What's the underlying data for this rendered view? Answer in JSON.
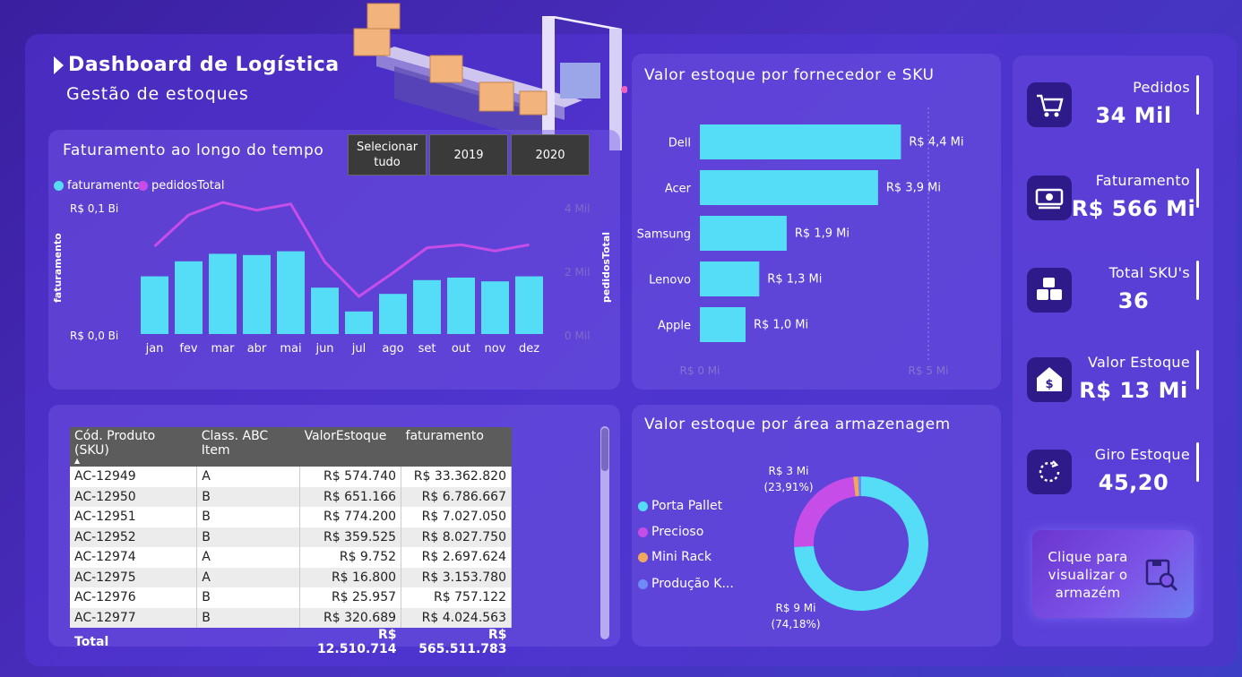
{
  "header": {
    "title": "Dashboard de Logística",
    "subtitle": "Gestão de estoques"
  },
  "colors": {
    "cyan": "#55ddf7",
    "magenta": "#c64de8",
    "orange": "#f0a860",
    "blue": "#6d8af5",
    "background": "#4a2fc0"
  },
  "line_chart": {
    "title": "Faturamento ao longo do tempo",
    "legend": [
      "faturamento",
      "pedidosTotal"
    ],
    "y_left_top": "R$ 0,1 Bi",
    "y_left_bottom": "R$ 0,0 Bi",
    "y_left_axis": "faturamento",
    "y_right_axis": "pedidosTotal",
    "y_right_ticks": [
      "4 Mil",
      "2 Mil",
      "0 Mil"
    ]
  },
  "slicers": [
    "Selecionar tudo",
    "2019",
    "2020"
  ],
  "bar_chart": {
    "title": "Valor estoque por fornecedor e SKU",
    "x_ticks": [
      "R$ 0 Mi",
      "R$ 5 Mi"
    ]
  },
  "donut": {
    "title": "Valor estoque por área armazenagem",
    "legend": [
      "Porta Pallet",
      "Precioso",
      "Mini Rack",
      "Produção K..."
    ],
    "label_small": "R$ 3 Mi",
    "label_small_pct": "(23,91%)",
    "label_big": "R$ 9 Mi",
    "label_big_pct": "(74,18%)"
  },
  "table": {
    "headers": [
      "Cód. Produto (SKU)",
      "Class. ABC Item",
      "ValorEstoque",
      "faturamento"
    ],
    "rows": [
      [
        "AC-12949",
        "A",
        "R$ 574.740",
        "R$ 33.362.820"
      ],
      [
        "AC-12950",
        "B",
        "R$ 651.166",
        "R$ 6.786.667"
      ],
      [
        "AC-12951",
        "B",
        "R$ 774.200",
        "R$ 7.027.050"
      ],
      [
        "AC-12952",
        "B",
        "R$ 359.525",
        "R$ 8.027.750"
      ],
      [
        "AC-12974",
        "A",
        "R$ 9.752",
        "R$ 2.697.624"
      ],
      [
        "AC-12975",
        "A",
        "R$ 16.800",
        "R$ 3.153.780"
      ],
      [
        "AC-12976",
        "B",
        "R$ 25.957",
        "R$ 757.122"
      ],
      [
        "AC-12977",
        "B",
        "R$ 320.689",
        "R$ 4.024.563"
      ]
    ],
    "total": [
      "Total",
      "",
      "R$ 12.510.714",
      "R$ 565.511.783"
    ]
  },
  "kpis": [
    {
      "label": "Pedidos",
      "value": "34 Mil",
      "icon": "cart-icon"
    },
    {
      "label": "Faturamento",
      "value": "R$ 566 Mi",
      "icon": "money-icon"
    },
    {
      "label": "Total SKU's",
      "value": "36",
      "icon": "boxes-icon"
    },
    {
      "label": "Valor Estoque",
      "value": "R$ 13 Mi",
      "icon": "warehouse-dollar-icon"
    },
    {
      "label": "Giro Estoque",
      "value": "45,20",
      "icon": "cycle-icon"
    }
  ],
  "cta": {
    "label": "Clique para visualizar o armazém",
    "icon": "search-box-icon"
  },
  "chart_data": [
    {
      "type": "bar",
      "title": "Faturamento ao longo do tempo",
      "categories": [
        "jan",
        "fev",
        "mar",
        "abr",
        "mai",
        "jun",
        "jul",
        "ago",
        "set",
        "out",
        "nov",
        "dez"
      ],
      "series": [
        {
          "name": "faturamento",
          "values": [
            0.046,
            0.058,
            0.064,
            0.063,
            0.066,
            0.037,
            0.018,
            0.032,
            0.043,
            0.045,
            0.042,
            0.046
          ]
        },
        {
          "name": "pedidosTotal",
          "values": [
            2800,
            3800,
            4200,
            3950,
            4150,
            2300,
            1200,
            1950,
            2750,
            2850,
            2650,
            2850
          ]
        }
      ],
      "ylim": [
        0,
        0.1
      ],
      "y2lim": [
        0,
        4000
      ]
    },
    {
      "type": "bar",
      "title": "Valor estoque por fornecedor e SKU",
      "categories": [
        "Dell",
        "Acer",
        "Samsung",
        "Lenovo",
        "Apple"
      ],
      "values": [
        4.4,
        3.9,
        1.9,
        1.3,
        1.0
      ],
      "data_labels": [
        "R$ 4,4 Mi",
        "R$ 3,9 Mi",
        "R$ 1,9 Mi",
        "R$ 1,3 Mi",
        "R$ 1,0 Mi"
      ],
      "xlim": [
        0,
        5
      ]
    },
    {
      "type": "pie",
      "title": "Valor estoque por área armazenagem",
      "categories": [
        "Porta Pallet",
        "Precioso",
        "Mini Rack",
        "Produção K..."
      ],
      "values": [
        74.18,
        23.91,
        1.2,
        0.71
      ]
    }
  ]
}
